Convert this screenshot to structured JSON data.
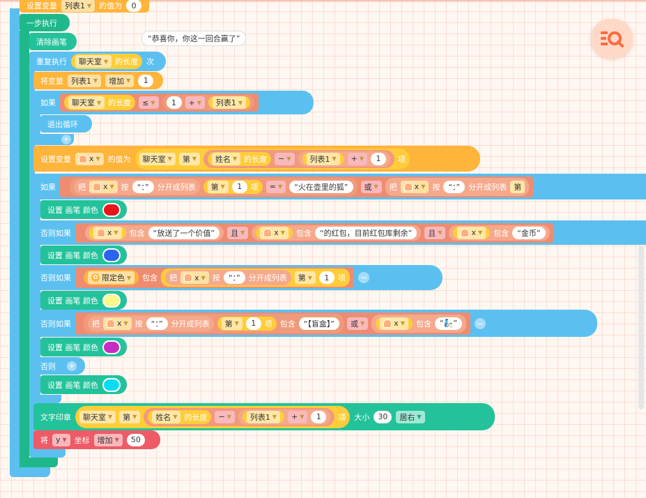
{
  "top": {
    "set_var": "设置变量",
    "list": "列表1",
    "value_of": "的值为",
    "zero": "0"
  },
  "step": "一步执行",
  "clear": "清除画笔",
  "note": "“恭喜你，你这一回合赢了”",
  "repeat": {
    "label": "重复执行",
    "chat": "聊天室",
    "length": "的长度",
    "times": "次"
  },
  "change": {
    "label": "将变量",
    "list": "列表1",
    "op": "增加",
    "value": "1"
  },
  "if1": {
    "label": "如果",
    "chat": "聊天室",
    "length": "的长度",
    "cmp": "≤",
    "one": "1",
    "plus": "+",
    "list": "列表1"
  },
  "break": "退出循环",
  "setx": {
    "label": "设置变量",
    "x": "x",
    "value_of": "的值为",
    "chat": "聊天室",
    "nth": "第",
    "name": "姓名",
    "length": "的长度",
    "minus": "−",
    "list": "列表1",
    "plus": "+",
    "one": "1",
    "item": "项"
  },
  "if2": {
    "label": "如果",
    "take": "把",
    "x": "x",
    "by": "按",
    "colon": "“：”",
    "split": "分开成列表",
    "nth": "第",
    "one": "1",
    "item": "项",
    "eq": "=",
    "fox": "“火在壶里的狐”",
    "or": "或"
  },
  "pen": {
    "label": "设置 画笔 颜色"
  },
  "elif1": {
    "label": "否则如果",
    "x": "x",
    "contains": "包含",
    "s1": "“放送了一个价值”",
    "and": "且",
    "s2": "“的红包，目前红包库剩余”",
    "s3": "“金币”"
  },
  "elif2": {
    "label": "否则如果",
    "color": "限定色",
    "contains": "包含",
    "take": "把",
    "x": "x",
    "by": "按",
    "colon": "“：”",
    "split": "分开成列表",
    "nth": "第",
    "one": "1",
    "item": "项"
  },
  "elif3": {
    "label": "否则如果",
    "take": "把",
    "x": "x",
    "by": "按",
    "colon": "“：”",
    "split": "分开成列表",
    "nth": "第",
    "one": "1",
    "item": "项",
    "contains": "包含",
    "box": "“【盲盒】”",
    "or": "或",
    "s": "“🧞”"
  },
  "else": "否则",
  "stamp": {
    "label": "文字印章",
    "chat": "聊天室",
    "nth": "第",
    "name": "姓名",
    "length": "的长度",
    "minus": "−",
    "list": "列表1",
    "plus": "+",
    "one": "1",
    "item": "项",
    "size": "大小",
    "size_val": "30",
    "align": "居右"
  },
  "move": {
    "label": "将",
    "axis": "y",
    "coord": "坐标",
    "op": "增加",
    "value": "50"
  },
  "colors": {
    "red": "#e8161b",
    "blue": "#2c64f0",
    "yellow": "#fbf98a",
    "magenta": "#c72cc4",
    "cyan": "#08dcf5",
    "control": "#5bc0f0",
    "pen": "#23c29a",
    "var": "#ffb43a",
    "motion": "#ef5a67"
  }
}
